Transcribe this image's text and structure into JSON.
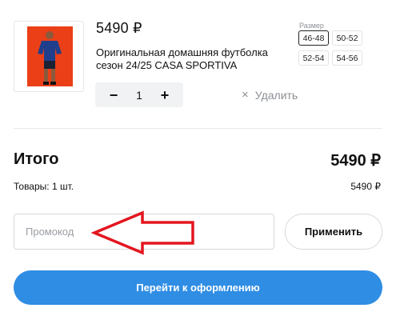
{
  "product": {
    "price": "5490 ₽",
    "title": "Оригинальная домашняя футболка сезон 24/25 CASA SPORTIVA",
    "image_icon": "product-photo"
  },
  "quantity": {
    "minus": "−",
    "value": "1",
    "plus": "+"
  },
  "remove": {
    "icon": "×",
    "label": "Удалить"
  },
  "sizes": {
    "label": "Размер",
    "options": [
      "46-48",
      "50-52",
      "52-54",
      "54-56"
    ],
    "selected": "46-48"
  },
  "summary": {
    "total_label": "Итого",
    "total_value": "5490 ₽",
    "goods_label": "Товары: 1 шт.",
    "goods_value": "5490 ₽"
  },
  "promo": {
    "placeholder": "Промокод",
    "value": "",
    "apply_label": "Применить"
  },
  "checkout": {
    "label": "Перейти к оформлению"
  },
  "colors": {
    "accent": "#2f8de4",
    "annotation_arrow": "#e3161f",
    "photo_background": "#ea3f17"
  }
}
